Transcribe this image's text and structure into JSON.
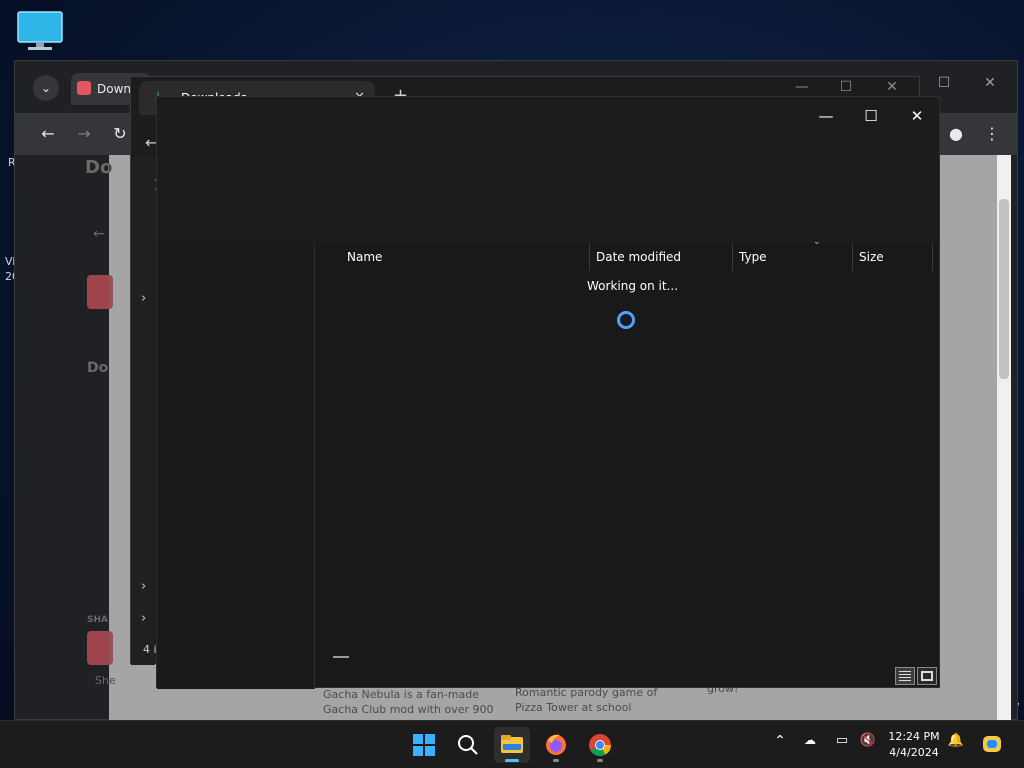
{
  "desktop": {
    "side_fragments": [
      "R",
      "Vi",
      "20",
      "v",
      "7"
    ]
  },
  "browser": {
    "tab_title": "Downl",
    "dropdown_glyph": "⌄",
    "page_heading_partial_1": "Do",
    "page_heading_partial_2": "Do",
    "share_partial": "SHA",
    "caption_partial": "She",
    "card1_text": "Gacha Nebula is a fan-made Gacha Club mod with over 900 new",
    "card2_text": "Romantic parody game of Pizza Tower at school",
    "card3_text": "grow!"
  },
  "explorer_back": {
    "tab_title": "Downloads",
    "new_tab_glyph": "+",
    "status_partial": "4 i"
  },
  "explorer": {
    "columns": [
      "Name",
      "Date modified",
      "Type",
      "Size"
    ],
    "loading_text": "Working on it..."
  },
  "taskbar": {
    "time": "12:24 PM",
    "date": "4/4/2024",
    "apps": [
      "start",
      "search",
      "file-explorer",
      "firefox",
      "chrome"
    ]
  },
  "colors": {
    "accent": "#4aa3ff",
    "taskbar_indicator": "#4fc3f7",
    "download_icon": "#3fbf6f"
  }
}
